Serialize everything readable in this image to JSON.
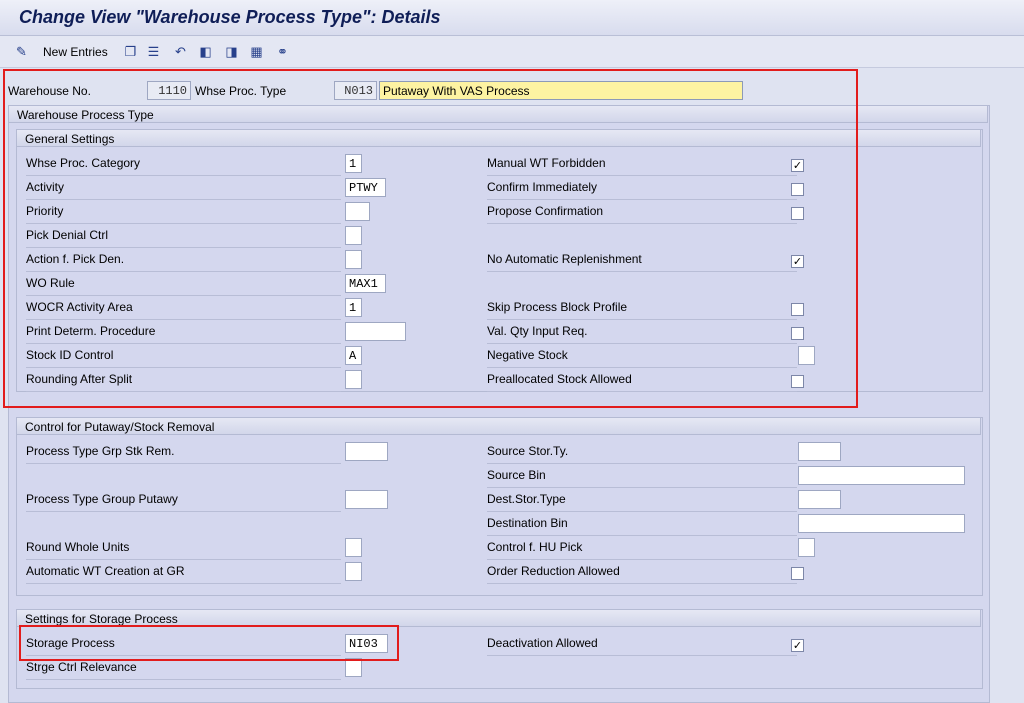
{
  "window": {
    "title": "Change View \"Warehouse Process Type\": Details"
  },
  "toolbar": {
    "new_entries_label": "New Entries",
    "icons": [
      "display-change-icon",
      "copy-icon",
      "delete-icon",
      "undo-icon",
      "previous-entry-icon",
      "next-entry-icon",
      "select-all-icon",
      "glasses-icon"
    ]
  },
  "header": {
    "warehouse_label": "Warehouse No.",
    "warehouse_value": "1110",
    "proc_type_label": "Whse Proc. Type",
    "proc_type_value": "N013",
    "description_value": "Putaway With VAS Process"
  },
  "main": {
    "section_title": "Warehouse Process Type"
  },
  "general": {
    "title": "General Settings",
    "left": [
      {
        "label": "Whse Proc. Category",
        "value": "1"
      },
      {
        "label": "Activity",
        "value": "PTWY"
      },
      {
        "label": "Priority",
        "value": ""
      },
      {
        "label": "Pick Denial Ctrl",
        "value": ""
      },
      {
        "label": "Action f. Pick Den.",
        "value": ""
      },
      {
        "label": "WO Rule",
        "value": "MAX1"
      },
      {
        "label": "WOCR Activity Area",
        "value": "1"
      },
      {
        "label": "Print Determ. Procedure",
        "value": ""
      },
      {
        "label": "Stock ID Control",
        "value": "A"
      },
      {
        "label": "Rounding After Split",
        "value": ""
      }
    ],
    "right": [
      {
        "label": "Manual WT Forbidden",
        "checked": "✓"
      },
      {
        "label": "Confirm Immediately",
        "checked": ""
      },
      {
        "label": "Propose Confirmation",
        "checked": ""
      },
      {
        "label": "No Automatic Replenishment",
        "checked": "✓"
      },
      {
        "label": "Skip Process Block Profile",
        "checked": ""
      },
      {
        "label": "Val. Qty Input Req.",
        "checked": ""
      },
      {
        "label": "Negative Stock",
        "value": ""
      },
      {
        "label": "Preallocated Stock Allowed",
        "checked": ""
      }
    ]
  },
  "putaway": {
    "title": "Control for Putaway/Stock Removal",
    "left": [
      {
        "label": "Process Type Grp Stk Rem.",
        "value": ""
      },
      {
        "label": "Process Type Group Putawy",
        "value": ""
      },
      {
        "label": "Round Whole Units",
        "value": ""
      },
      {
        "label": "Automatic WT Creation at GR",
        "value": ""
      }
    ],
    "right": [
      {
        "label": "Source Stor.Ty.",
        "value": ""
      },
      {
        "label": "Source Bin",
        "value": ""
      },
      {
        "label": "Dest.Stor.Type",
        "value": ""
      },
      {
        "label": "Destination Bin",
        "value": ""
      },
      {
        "label": "Control f. HU Pick",
        "value": ""
      },
      {
        "label": "Order Reduction Allowed",
        "checked": ""
      }
    ]
  },
  "storage": {
    "title": "Settings for Storage Process",
    "storage_process_label": "Storage Process",
    "storage_process_value": "NI03",
    "ctrl_relevance_label": "Strge Ctrl Relevance",
    "ctrl_relevance_value": "",
    "deactivation_label": "Deactivation Allowed",
    "deactivation_checked": "✓"
  }
}
